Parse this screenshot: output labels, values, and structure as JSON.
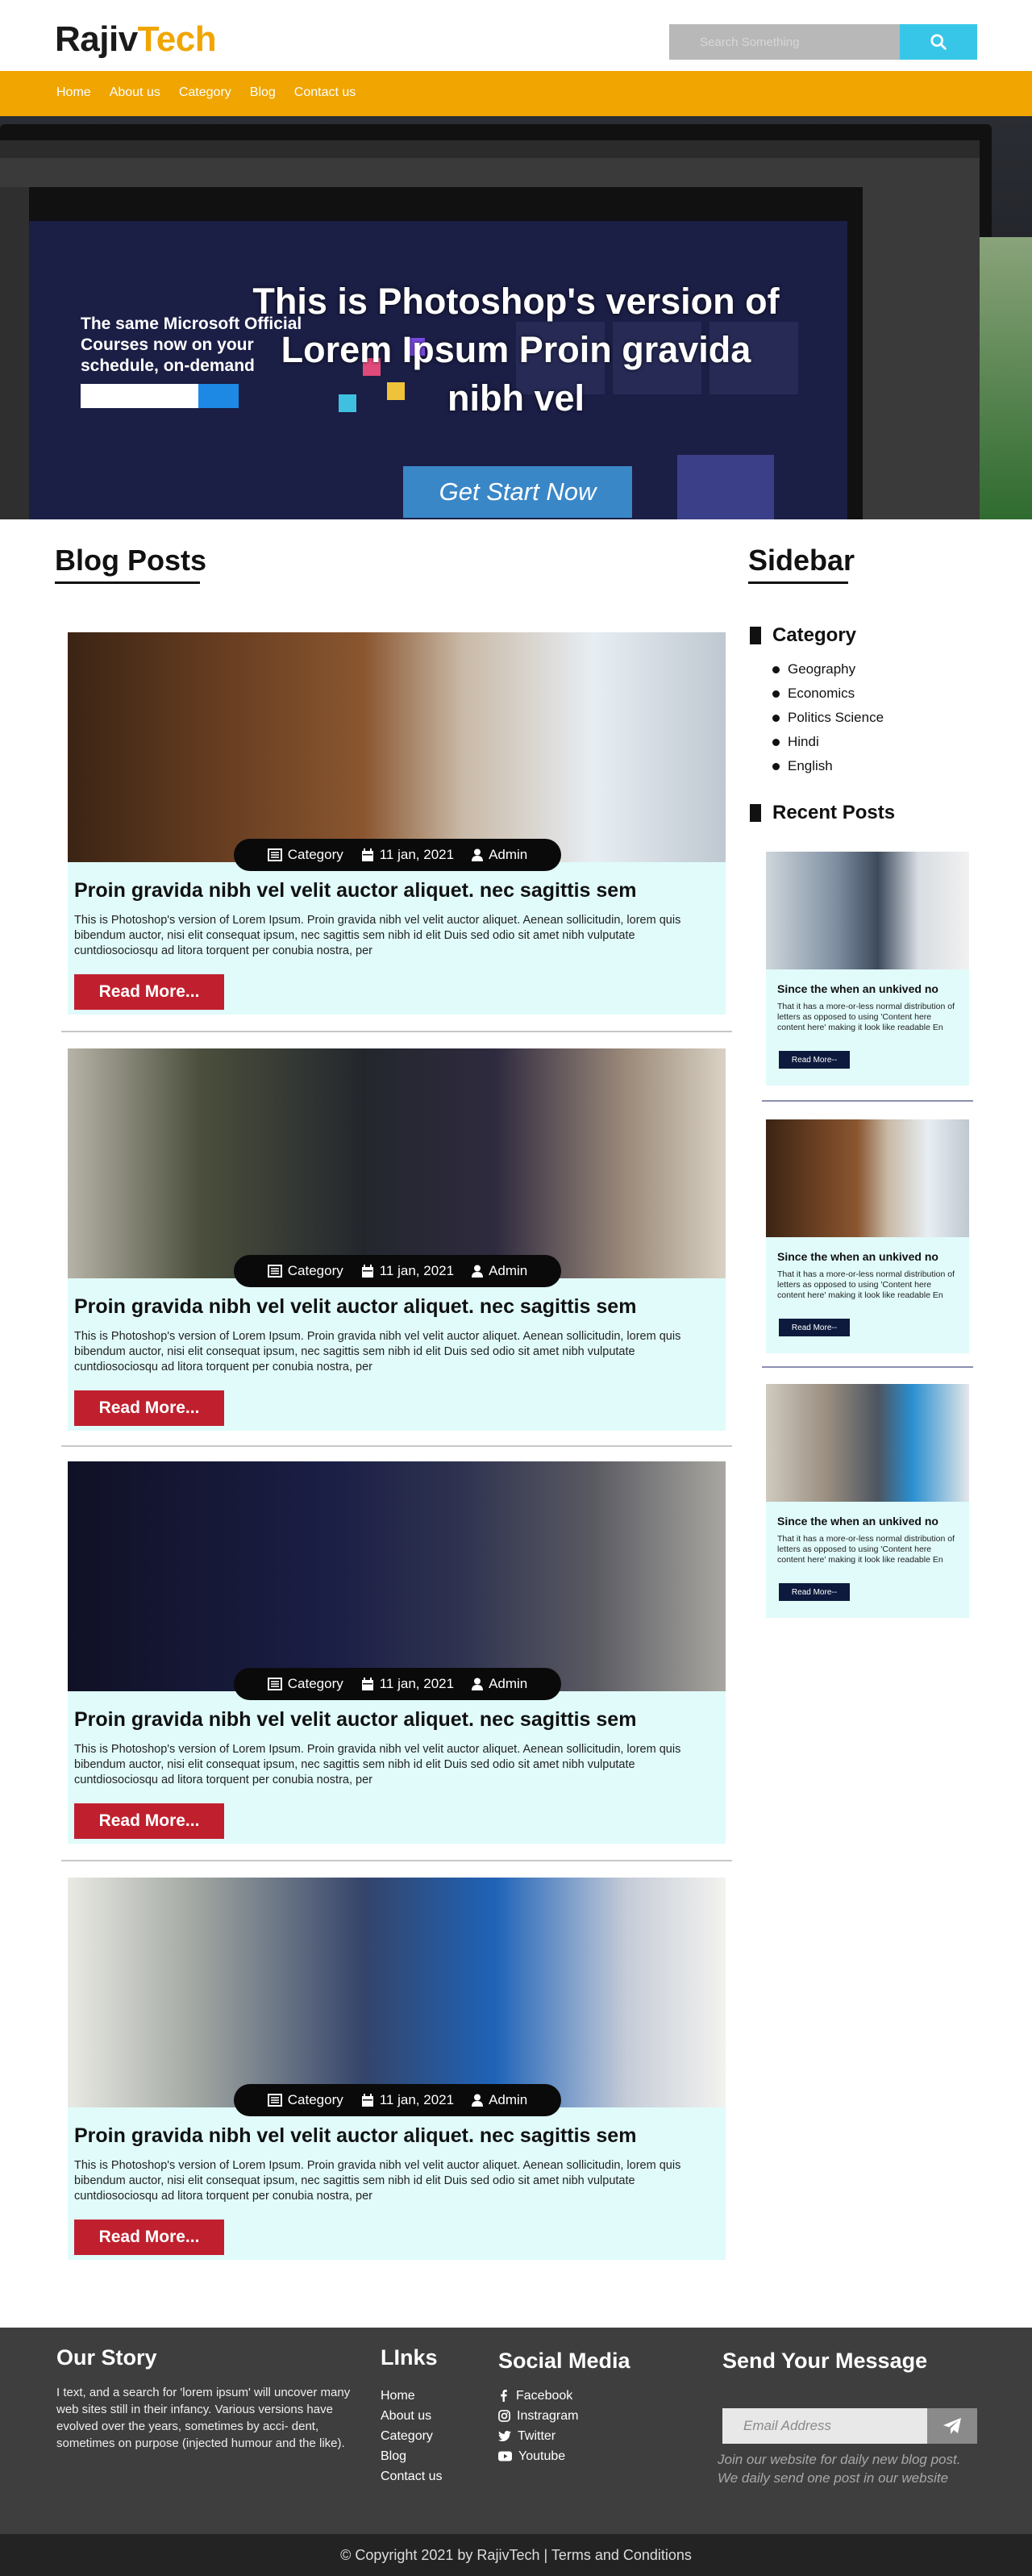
{
  "header": {
    "logo_part1": "Rajiv",
    "logo_part2": "Tech",
    "search_placeholder": "Search Something",
    "search_icon": "search-icon"
  },
  "nav": {
    "items": [
      "Home",
      "About us",
      "Category",
      "Blog",
      "Contact us"
    ]
  },
  "hero": {
    "title": "This is Photoshop's version of Lorem Ipsum Proin gravida nibh vel",
    "button": "Get Start Now",
    "screen_text": "The same Microsoft Official Courses now on your schedule, on-demand"
  },
  "blog": {
    "heading": "Blog Posts",
    "posts": [
      {
        "category": "Category",
        "date": "11 jan, 2021",
        "author": "Admin",
        "title": "Proin gravida nibh vel velit auctor aliquet. nec sagittis sem",
        "excerpt": "This is Photoshop's version  of Lorem Ipsum. Proin gravida nibh vel velit auctor aliquet. Aenean sollicitudin, lorem quis bibendum auctor, nisi elit consequat ipsum, nec sagittis sem nibh id elit Duis sed odio sit amet nibh vulputate cuntdiosociosqu ad litora torquent per conubia nostra, per",
        "read_more": "Read More..."
      },
      {
        "category": "Category",
        "date": "11 jan, 2021",
        "author": "Admin",
        "title": "Proin gravida nibh vel velit auctor aliquet. nec sagittis sem",
        "excerpt": "This is Photoshop's version  of Lorem Ipsum. Proin gravida nibh vel velit auctor aliquet. Aenean sollicitudin, lorem quis bibendum auctor, nisi elit consequat ipsum, nec sagittis sem nibh id elit Duis sed odio sit amet nibh vulputate cuntdiosociosqu ad litora torquent per conubia nostra, per",
        "read_more": "Read More..."
      },
      {
        "category": "Category",
        "date": "11 jan, 2021",
        "author": "Admin",
        "title": "Proin gravida nibh vel velit auctor aliquet. nec sagittis sem",
        "excerpt": "This is Photoshop's version  of Lorem Ipsum. Proin gravida nibh vel velit auctor aliquet. Aenean sollicitudin, lorem quis bibendum auctor, nisi elit consequat ipsum, nec sagittis sem nibh id elit Duis sed odio sit amet nibh vulputate cuntdiosociosqu ad litora torquent per conubia nostra, per",
        "read_more": "Read More..."
      },
      {
        "category": "Category",
        "date": "11 jan, 2021",
        "author": "Admin",
        "title": "Proin gravida nibh vel velit auctor aliquet. nec sagittis sem",
        "excerpt": "This is Photoshop's version  of Lorem Ipsum. Proin gravida nibh vel velit auctor aliquet. Aenean sollicitudin, lorem quis bibendum auctor, nisi elit consequat ipsum, nec sagittis sem nibh id elit Duis sed odio sit amet nibh vulputate cuntdiosociosqu ad litora torquent per conubia nostra, per",
        "read_more": "Read More..."
      }
    ]
  },
  "sidebar": {
    "heading": "Sidebar",
    "category_title": "Category",
    "categories": [
      "Geography",
      "Economics",
      "Politics Science",
      "Hindi",
      "English"
    ],
    "recent_title": "Recent Posts",
    "recent_posts": [
      {
        "title": "Since the  when an unkived no",
        "text": "That it has a more-or-less normal distribution of letters as opposed to using 'Content here content here' making it look like readable En",
        "button": "Read More--"
      },
      {
        "title": "Since the  when an unkived no",
        "text": "That it has a more-or-less normal distribution of letters as opposed to using 'Content here content here' making it look like readable En",
        "button": "Read More--"
      },
      {
        "title": "Since the  when an unkived no",
        "text": "That it has a more-or-less normal distribution of letters as opposed to using 'Content here content here' making it look like readable En",
        "button": "Read More--"
      }
    ]
  },
  "footer": {
    "story_title": "Our Story",
    "story_text": "I text, and a search for 'lorem ipsum' will uncover many web sites still in their infancy. Various versions have evolved over the years, sometimes by acci- dent, sometimes on purpose (injected humour and the like).",
    "links_title": "LInks",
    "links": [
      "Home",
      "About us",
      "Category",
      "Blog",
      "Contact us"
    ],
    "social_title": "Social Media",
    "social": [
      {
        "label": "Facebook",
        "icon": "facebook-icon"
      },
      {
        "label": "Instragram",
        "icon": "instagram-icon"
      },
      {
        "label": "Twitter",
        "icon": "twitter-icon"
      },
      {
        "label": "Youtube",
        "icon": "youtube-icon"
      }
    ],
    "message_title": "Send Your Message",
    "email_placeholder": "Email Address",
    "join_text": "Join our website for daily new blog post. We daily send one post in our website",
    "copyright": "© Copyright 2021 by RajivTech | Terms and Conditions"
  },
  "colors": {
    "brand_orange": "#f0a500",
    "search_button": "#38c6e8",
    "read_more_red": "#c0202e",
    "card_bg": "#e0fbfa",
    "footer_bg": "#3e3e3e"
  }
}
